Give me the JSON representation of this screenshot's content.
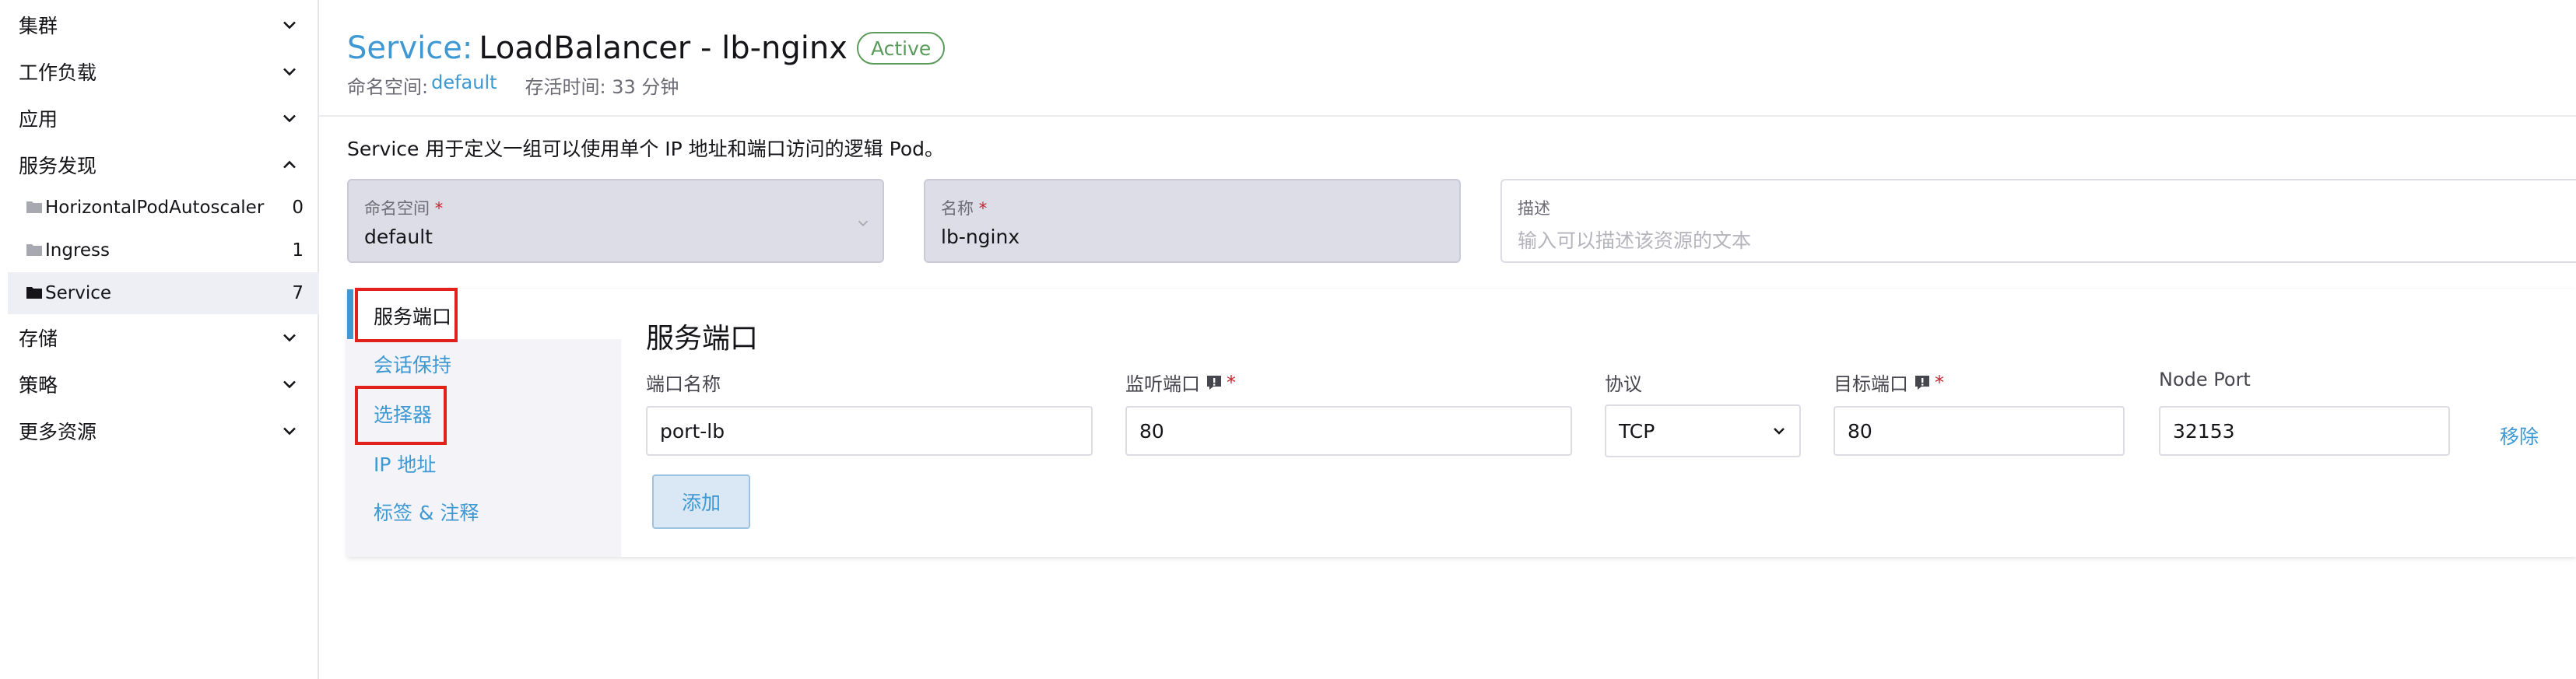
{
  "sidebar": {
    "groups": [
      {
        "label": "集群"
      },
      {
        "label": "工作负载"
      },
      {
        "label": "应用"
      },
      {
        "label": "服务发现"
      },
      {
        "label": "存储"
      },
      {
        "label": "策略"
      },
      {
        "label": "更多资源"
      }
    ],
    "sub_items": [
      {
        "label": "HorizontalPodAutoscaler",
        "count": "0"
      },
      {
        "label": "Ingress",
        "count": "1"
      },
      {
        "label": "Service",
        "count": "7"
      }
    ]
  },
  "header": {
    "kind": "Service:",
    "name": "LoadBalancer - lb-nginx",
    "status": "Active",
    "namespace_label": "命名空间:",
    "namespace_value": "default",
    "age": "存活时间: 33 分钟"
  },
  "description": "Service 用于定义一组可以使用单个 IP 地址和端口访问的逻辑 Pod。",
  "form": {
    "namespace": {
      "label": "命名空间",
      "req": "*",
      "value": "default"
    },
    "name": {
      "label": "名称",
      "req": "*",
      "value": "lb-nginx"
    },
    "desc": {
      "label": "描述",
      "placeholder": "输入可以描述该资源的文本"
    }
  },
  "tabs": [
    {
      "label": "服务端口"
    },
    {
      "label": "会话保持"
    },
    {
      "label": "选择器"
    },
    {
      "label": "IP 地址"
    },
    {
      "label": "标签 & 注释"
    }
  ],
  "ports": {
    "title": "服务端口",
    "columns": {
      "name": "端口名称",
      "listen": "监听端口",
      "protocol": "协议",
      "target": "目标端口",
      "node_port": "Node Port",
      "req": "*"
    },
    "row": {
      "name": "port-lb",
      "listen": "80",
      "protocol": "TCP",
      "target": "80",
      "node_port": "32153",
      "remove": "移除"
    },
    "add": "添加"
  },
  "colors": {
    "accent": "#3d98d3",
    "active_badge": "#5a9a5a",
    "highlight": "#e3211c",
    "required": "#c4262e"
  }
}
